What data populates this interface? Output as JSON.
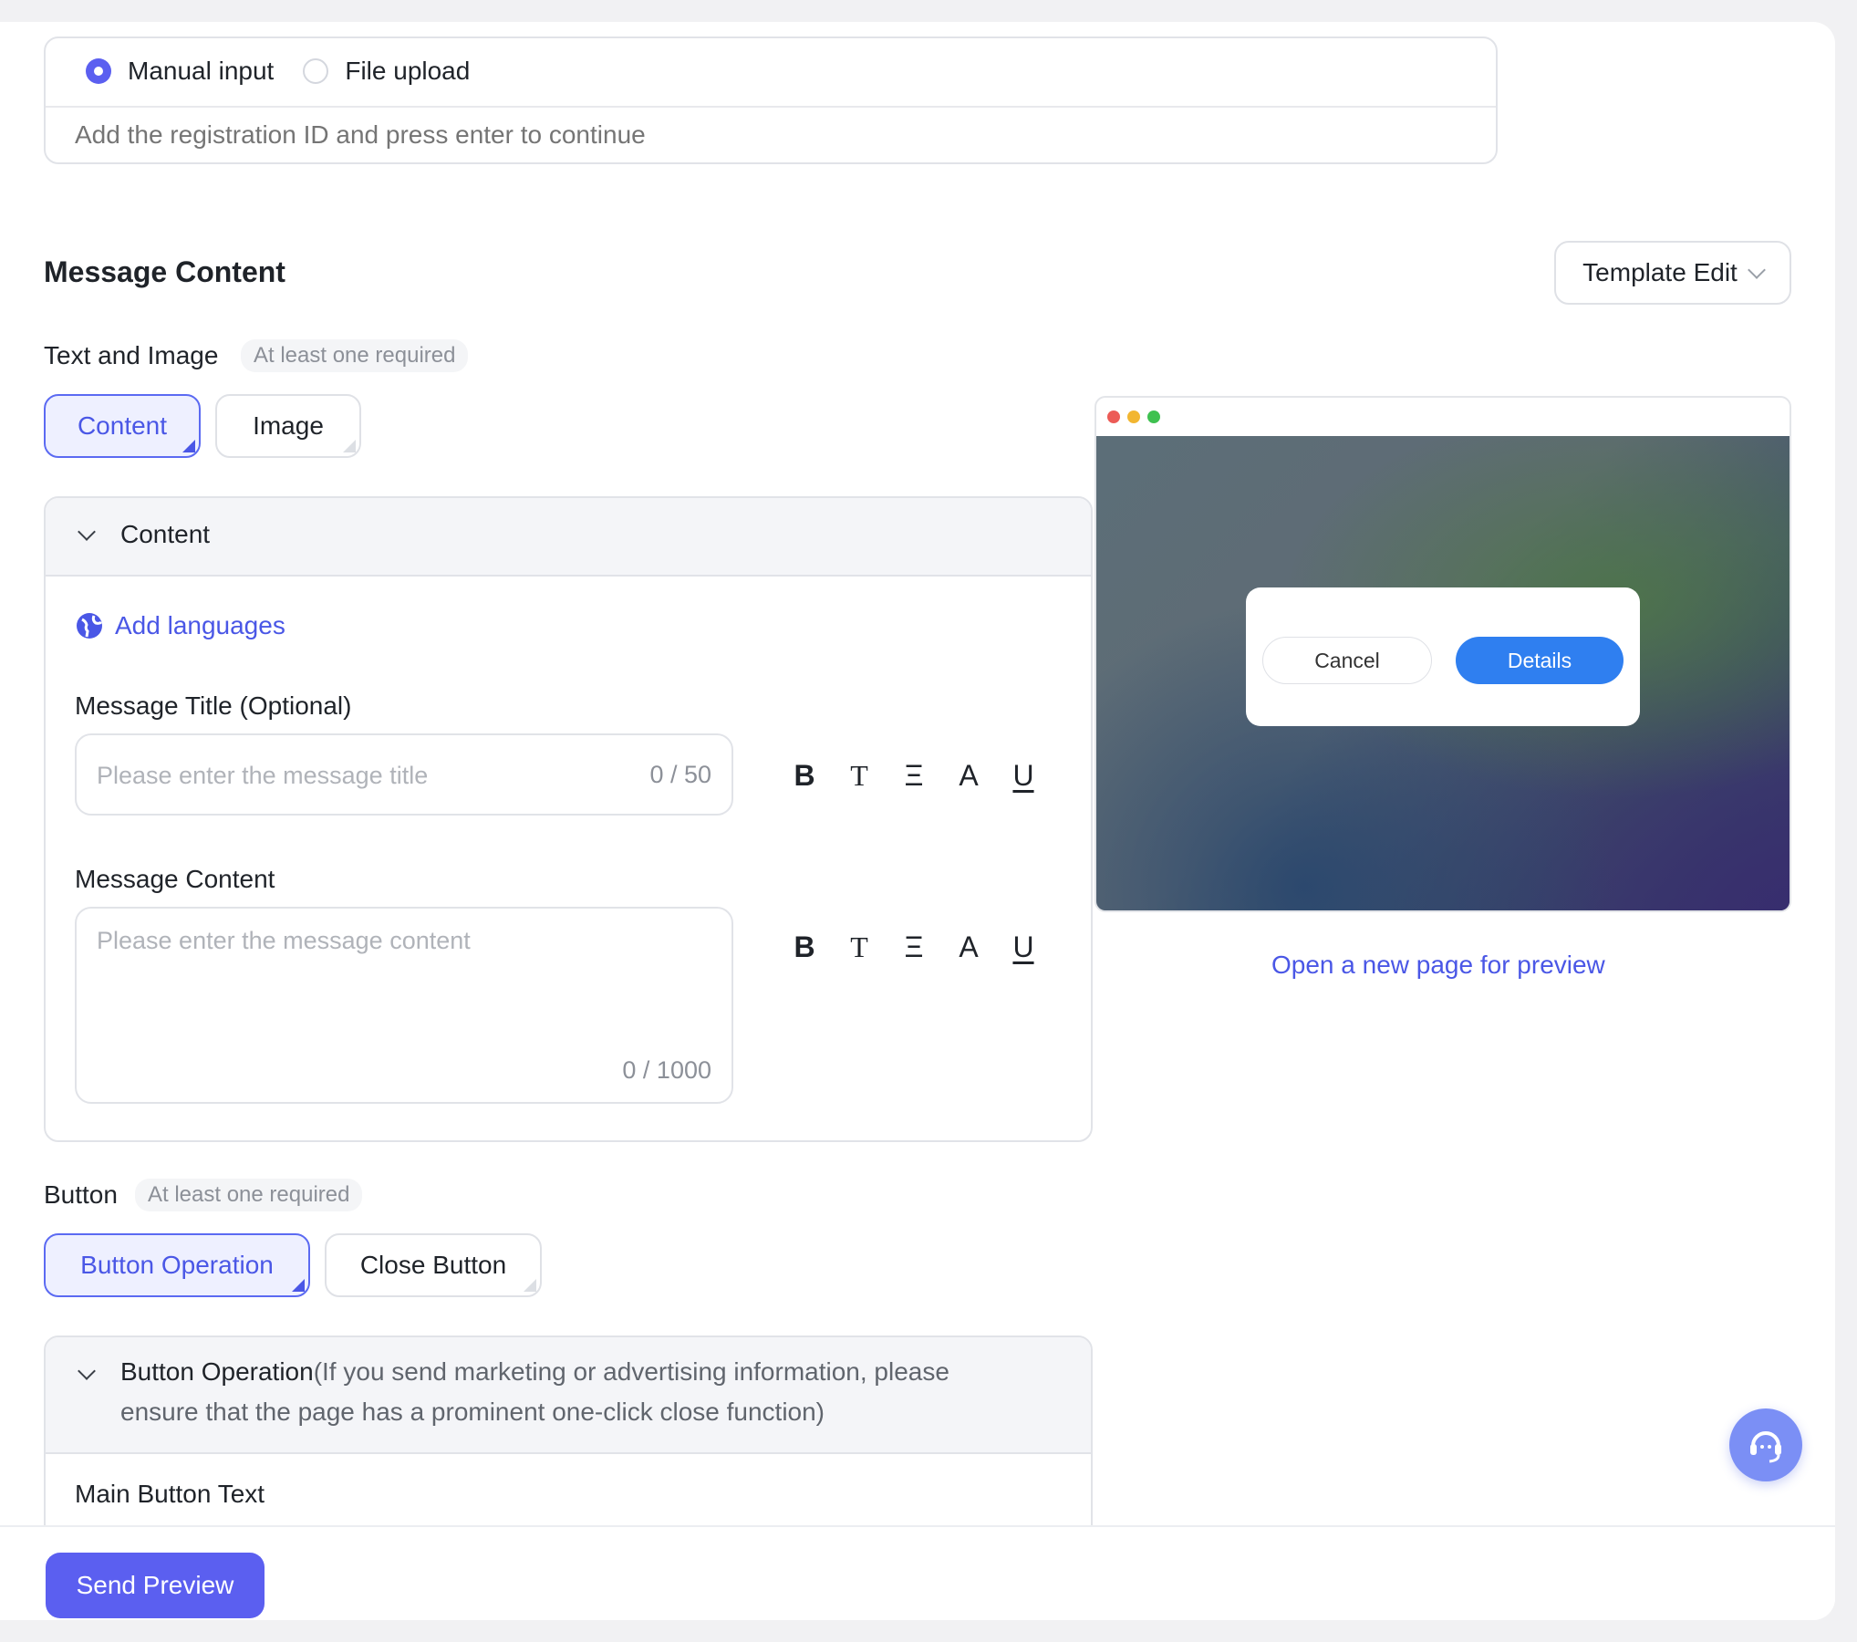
{
  "recipient": {
    "options": [
      "Manual input",
      "File upload"
    ],
    "selected": "Manual input",
    "input_placeholder": "Add the registration ID and press enter to continue"
  },
  "message_section": {
    "title": "Message Content",
    "template_button": "Template Edit"
  },
  "text_image": {
    "label": "Text and Image",
    "hint": "At least one required",
    "tabs": [
      "Content",
      "Image"
    ],
    "active_tab": "Content"
  },
  "content_panel": {
    "header": "Content",
    "add_languages": "Add languages",
    "title_label": "Message Title (Optional)",
    "title_placeholder": "Please enter the message title",
    "title_counter": "0 / 50",
    "content_label": "Message Content",
    "content_placeholder": "Please enter the message content",
    "content_counter": "0 / 1000",
    "format_tools": [
      "B",
      "T",
      "Ξ",
      "A",
      "U"
    ]
  },
  "button_section": {
    "label": "Button",
    "hint": "At least one required",
    "tabs": [
      "Button Operation",
      "Close Button"
    ],
    "active_tab": "Button Operation"
  },
  "button_panel": {
    "header_main": "Button Operation",
    "header_note_line1": "(If you send marketing or advertising information, please",
    "header_note_line2": "ensure that the page has a prominent one-click close function)",
    "main_button_text_label": "Main Button Text"
  },
  "preview": {
    "cancel": "Cancel",
    "details": "Details",
    "open_link": "Open a new page for preview",
    "dot_colors": [
      "#ec5b56",
      "#f2b631",
      "#3fc150"
    ]
  },
  "footer": {
    "send_preview": "Send Preview"
  },
  "colors": {
    "accent": "#5b5ff0",
    "link": "#4a57e6",
    "preview_primary": "#2f7ff0"
  }
}
